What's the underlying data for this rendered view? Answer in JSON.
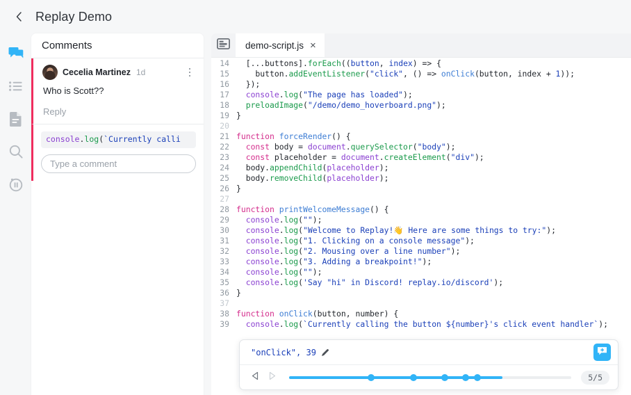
{
  "header": {
    "back_icon": "chevron-left-icon",
    "title": "Replay Demo"
  },
  "rail": {
    "items": [
      {
        "icon": "comments-icon",
        "name": "comments",
        "active": true
      },
      {
        "icon": "list-icon",
        "name": "events",
        "active": false
      },
      {
        "icon": "document-icon",
        "name": "source",
        "active": false
      },
      {
        "icon": "search-icon",
        "name": "search",
        "active": false
      },
      {
        "icon": "pause-record-icon",
        "name": "recording",
        "active": false
      }
    ]
  },
  "comments": {
    "header": "Comments",
    "thread": {
      "author": "Cecelia Martinez",
      "time": "1d",
      "body": "Who is Scott??",
      "reply_label": "Reply",
      "menu_icon": "kebab-menu-icon",
      "avatar_name": "avatar"
    },
    "compose": {
      "code_chip": [
        {
          "text": "console",
          "cls": "t-obj"
        },
        {
          "text": ".",
          "cls": "t-pun"
        },
        {
          "text": "log",
          "cls": "t-meth"
        },
        {
          "text": "(",
          "cls": "t-pun"
        },
        {
          "text": "`Currently calli",
          "cls": "t-str"
        }
      ],
      "input_value": "",
      "input_placeholder": "Type a comment"
    }
  },
  "editor": {
    "tab_icon": "source-panel-icon",
    "tab_label": "demo-script.js",
    "tab_close_glyph": "×",
    "lines": [
      {
        "n": "14",
        "dim": false,
        "partial": true,
        "tokens": [
          {
            "text": "  [...",
            "cls": "t-pun"
          },
          {
            "text": "buttons",
            "cls": "t-var"
          },
          {
            "text": "].",
            "cls": "t-pun"
          },
          {
            "text": "forEach",
            "cls": "t-meth"
          },
          {
            "text": "((",
            "cls": "t-pun"
          },
          {
            "text": "button",
            "cls": "t-str"
          },
          {
            "text": ", ",
            "cls": "t-pun"
          },
          {
            "text": "index",
            "cls": "t-str"
          },
          {
            "text": ") => {",
            "cls": "t-pun"
          }
        ]
      },
      {
        "n": "15",
        "dim": false,
        "tokens": [
          {
            "text": "    button",
            "cls": "t-var"
          },
          {
            "text": ".",
            "cls": "t-pun"
          },
          {
            "text": "addEventListener",
            "cls": "t-meth"
          },
          {
            "text": "(",
            "cls": "t-pun"
          },
          {
            "text": "\"click\"",
            "cls": "t-str"
          },
          {
            "text": ", () => ",
            "cls": "t-pun"
          },
          {
            "text": "onClick",
            "cls": "t-fn"
          },
          {
            "text": "(",
            "cls": "t-pun"
          },
          {
            "text": "button",
            "cls": "t-var"
          },
          {
            "text": ", ",
            "cls": "t-pun"
          },
          {
            "text": "index",
            "cls": "t-var"
          },
          {
            "text": " + ",
            "cls": "t-pun"
          },
          {
            "text": "1",
            "cls": "t-num"
          },
          {
            "text": "));",
            "cls": "t-pun"
          }
        ]
      },
      {
        "n": "16",
        "dim": false,
        "tokens": [
          {
            "text": "  });",
            "cls": "t-pun"
          }
        ]
      },
      {
        "n": "17",
        "dim": false,
        "tokens": [
          {
            "text": "  ",
            "cls": "t-pun"
          },
          {
            "text": "console",
            "cls": "t-obj"
          },
          {
            "text": ".",
            "cls": "t-pun"
          },
          {
            "text": "log",
            "cls": "t-meth"
          },
          {
            "text": "(",
            "cls": "t-pun"
          },
          {
            "text": "\"The page has loaded\"",
            "cls": "t-str"
          },
          {
            "text": ");",
            "cls": "t-pun"
          }
        ]
      },
      {
        "n": "18",
        "dim": false,
        "tokens": [
          {
            "text": "  ",
            "cls": "t-pun"
          },
          {
            "text": "preloadImage",
            "cls": "t-meth"
          },
          {
            "text": "(",
            "cls": "t-pun"
          },
          {
            "text": "\"/demo/demo_hoverboard.png\"",
            "cls": "t-str"
          },
          {
            "text": ");",
            "cls": "t-pun"
          }
        ]
      },
      {
        "n": "19",
        "dim": false,
        "tokens": [
          {
            "text": "}",
            "cls": "t-pun"
          }
        ]
      },
      {
        "n": "20",
        "dim": true,
        "tokens": []
      },
      {
        "n": "21",
        "dim": false,
        "tokens": [
          {
            "text": "function ",
            "cls": "t-kw"
          },
          {
            "text": "forceRender",
            "cls": "t-fn"
          },
          {
            "text": "() {",
            "cls": "t-pun"
          }
        ]
      },
      {
        "n": "22",
        "dim": false,
        "tokens": [
          {
            "text": "  ",
            "cls": "t-pun"
          },
          {
            "text": "const",
            "cls": "t-kw"
          },
          {
            "text": " body = ",
            "cls": "t-var"
          },
          {
            "text": "document",
            "cls": "t-obj"
          },
          {
            "text": ".",
            "cls": "t-pun"
          },
          {
            "text": "querySelector",
            "cls": "t-meth"
          },
          {
            "text": "(",
            "cls": "t-pun"
          },
          {
            "text": "\"body\"",
            "cls": "t-str"
          },
          {
            "text": ");",
            "cls": "t-pun"
          }
        ]
      },
      {
        "n": "23",
        "dim": false,
        "tokens": [
          {
            "text": "  ",
            "cls": "t-pun"
          },
          {
            "text": "const",
            "cls": "t-kw"
          },
          {
            "text": " placeholder = ",
            "cls": "t-var"
          },
          {
            "text": "document",
            "cls": "t-obj"
          },
          {
            "text": ".",
            "cls": "t-pun"
          },
          {
            "text": "createElement",
            "cls": "t-meth"
          },
          {
            "text": "(",
            "cls": "t-pun"
          },
          {
            "text": "\"div\"",
            "cls": "t-str"
          },
          {
            "text": ");",
            "cls": "t-pun"
          }
        ]
      },
      {
        "n": "24",
        "dim": false,
        "tokens": [
          {
            "text": "  body",
            "cls": "t-var"
          },
          {
            "text": ".",
            "cls": "t-pun"
          },
          {
            "text": "appendChild",
            "cls": "t-meth"
          },
          {
            "text": "(",
            "cls": "t-pun"
          },
          {
            "text": "placeholder",
            "cls": "t-obj"
          },
          {
            "text": ");",
            "cls": "t-pun"
          }
        ]
      },
      {
        "n": "25",
        "dim": false,
        "tokens": [
          {
            "text": "  body",
            "cls": "t-var"
          },
          {
            "text": ".",
            "cls": "t-pun"
          },
          {
            "text": "removeChild",
            "cls": "t-meth"
          },
          {
            "text": "(",
            "cls": "t-pun"
          },
          {
            "text": "placeholder",
            "cls": "t-obj"
          },
          {
            "text": ");",
            "cls": "t-pun"
          }
        ]
      },
      {
        "n": "26",
        "dim": false,
        "tokens": [
          {
            "text": "}",
            "cls": "t-pun"
          }
        ]
      },
      {
        "n": "27",
        "dim": true,
        "tokens": []
      },
      {
        "n": "28",
        "dim": false,
        "tokens": [
          {
            "text": "function ",
            "cls": "t-kw"
          },
          {
            "text": "printWelcomeMessage",
            "cls": "t-fn"
          },
          {
            "text": "() {",
            "cls": "t-pun"
          }
        ]
      },
      {
        "n": "29",
        "dim": false,
        "tokens": [
          {
            "text": "  ",
            "cls": "t-pun"
          },
          {
            "text": "console",
            "cls": "t-obj"
          },
          {
            "text": ".",
            "cls": "t-pun"
          },
          {
            "text": "log",
            "cls": "t-meth"
          },
          {
            "text": "(",
            "cls": "t-pun"
          },
          {
            "text": "\"\"",
            "cls": "t-str"
          },
          {
            "text": ");",
            "cls": "t-pun"
          }
        ]
      },
      {
        "n": "30",
        "dim": false,
        "tokens": [
          {
            "text": "  ",
            "cls": "t-pun"
          },
          {
            "text": "console",
            "cls": "t-obj"
          },
          {
            "text": ".",
            "cls": "t-pun"
          },
          {
            "text": "log",
            "cls": "t-meth"
          },
          {
            "text": "(",
            "cls": "t-pun"
          },
          {
            "text": "\"Welcome to Replay!👋 Here are some things to try:\"",
            "cls": "t-str"
          },
          {
            "text": ");",
            "cls": "t-pun"
          }
        ]
      },
      {
        "n": "31",
        "dim": false,
        "tokens": [
          {
            "text": "  ",
            "cls": "t-pun"
          },
          {
            "text": "console",
            "cls": "t-obj"
          },
          {
            "text": ".",
            "cls": "t-pun"
          },
          {
            "text": "log",
            "cls": "t-meth"
          },
          {
            "text": "(",
            "cls": "t-pun"
          },
          {
            "text": "\"1. Clicking on a console message\"",
            "cls": "t-str"
          },
          {
            "text": ");",
            "cls": "t-pun"
          }
        ]
      },
      {
        "n": "32",
        "dim": false,
        "tokens": [
          {
            "text": "  ",
            "cls": "t-pun"
          },
          {
            "text": "console",
            "cls": "t-obj"
          },
          {
            "text": ".",
            "cls": "t-pun"
          },
          {
            "text": "log",
            "cls": "t-meth"
          },
          {
            "text": "(",
            "cls": "t-pun"
          },
          {
            "text": "\"2. Mousing over a line number\"",
            "cls": "t-str"
          },
          {
            "text": ");",
            "cls": "t-pun"
          }
        ]
      },
      {
        "n": "33",
        "dim": false,
        "tokens": [
          {
            "text": "  ",
            "cls": "t-pun"
          },
          {
            "text": "console",
            "cls": "t-obj"
          },
          {
            "text": ".",
            "cls": "t-pun"
          },
          {
            "text": "log",
            "cls": "t-meth"
          },
          {
            "text": "(",
            "cls": "t-pun"
          },
          {
            "text": "\"3. Adding a breakpoint!\"",
            "cls": "t-str"
          },
          {
            "text": ");",
            "cls": "t-pun"
          }
        ]
      },
      {
        "n": "34",
        "dim": false,
        "tokens": [
          {
            "text": "  ",
            "cls": "t-pun"
          },
          {
            "text": "console",
            "cls": "t-obj"
          },
          {
            "text": ".",
            "cls": "t-pun"
          },
          {
            "text": "log",
            "cls": "t-meth"
          },
          {
            "text": "(",
            "cls": "t-pun"
          },
          {
            "text": "\"\"",
            "cls": "t-str"
          },
          {
            "text": ");",
            "cls": "t-pun"
          }
        ]
      },
      {
        "n": "35",
        "dim": false,
        "tokens": [
          {
            "text": "  ",
            "cls": "t-pun"
          },
          {
            "text": "console",
            "cls": "t-obj"
          },
          {
            "text": ".",
            "cls": "t-pun"
          },
          {
            "text": "log",
            "cls": "t-meth"
          },
          {
            "text": "(",
            "cls": "t-pun"
          },
          {
            "text": "'Say \"hi\" in Discord! replay.io/discord'",
            "cls": "t-str"
          },
          {
            "text": ");",
            "cls": "t-pun"
          }
        ]
      },
      {
        "n": "36",
        "dim": false,
        "tokens": [
          {
            "text": "}",
            "cls": "t-pun"
          }
        ]
      },
      {
        "n": "37",
        "dim": true,
        "tokens": []
      },
      {
        "n": "38",
        "dim": false,
        "tokens": [
          {
            "text": "function ",
            "cls": "t-kw"
          },
          {
            "text": "onClick",
            "cls": "t-fn"
          },
          {
            "text": "(",
            "cls": "t-pun"
          },
          {
            "text": "button",
            "cls": "t-var"
          },
          {
            "text": ", ",
            "cls": "t-pun"
          },
          {
            "text": "number",
            "cls": "t-var"
          },
          {
            "text": ") {",
            "cls": "t-pun"
          }
        ]
      },
      {
        "n": "39",
        "dim": false,
        "tokens": [
          {
            "text": "  ",
            "cls": "t-pun"
          },
          {
            "text": "console",
            "cls": "t-obj"
          },
          {
            "text": ".",
            "cls": "t-pun"
          },
          {
            "text": "log",
            "cls": "t-meth"
          },
          {
            "text": "(",
            "cls": "t-pun"
          },
          {
            "text": "`Currently calling the button ${number}'s click event handler`",
            "cls": "t-str"
          },
          {
            "text": ");",
            "cls": "t-pun"
          }
        ]
      }
    ]
  },
  "timeline": {
    "label": "\"onClick\", 39",
    "edit_icon": "pencil-icon",
    "add_comment_icon": "add-comment-icon",
    "prev_icon": "prev-hit-icon",
    "next_icon": "next-hit-icon",
    "counter": "5/5",
    "fill_percent": 75.5,
    "ticks_percent": [
      29.1,
      44.1,
      55.2,
      62.6,
      66.8
    ]
  },
  "colors": {
    "accent": "#31b4f7",
    "comment_marker": "#f02d5e",
    "page_bg": "#f6f7f8"
  }
}
